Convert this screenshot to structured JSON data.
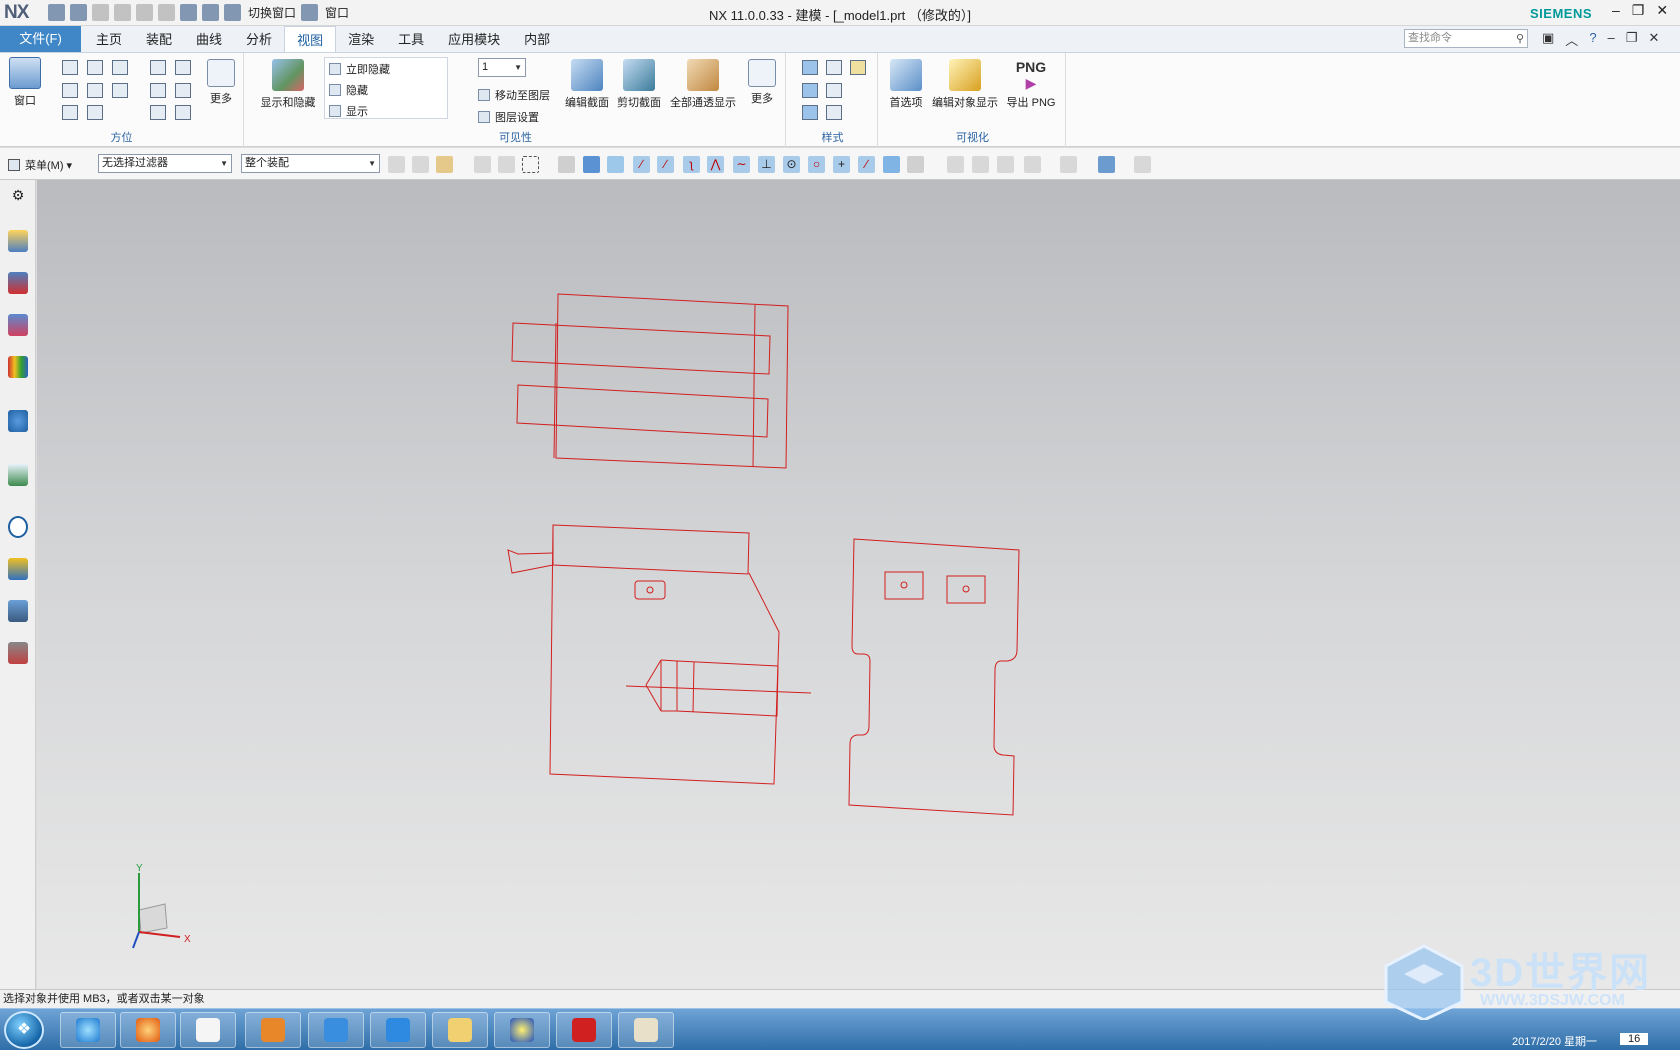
{
  "app": {
    "logo": "NX",
    "title": "NX 11.0.0.33 - 建模 - [_model1.prt （修改的）]",
    "brand": "SIEMENS",
    "switch_window": "切换窗口",
    "window": "窗口"
  },
  "menu": {
    "file": "文件(F)",
    "tabs": [
      "主页",
      "装配",
      "曲线",
      "分析",
      "视图",
      "渲染",
      "工具",
      "应用模块",
      "内部"
    ],
    "search_placeholder": "查找命令"
  },
  "ribbon": {
    "orient": {
      "window_label": "窗口",
      "more": "更多",
      "group": "方位"
    },
    "visibility": {
      "show_hide": "显示和隐藏",
      "immediate_hide": "立即隐藏",
      "hide": "隐藏",
      "show": "显示",
      "layer_value": "1",
      "move_to_layer": "移动至图层",
      "layer_settings": "图层设置",
      "edit_section": "编辑截面",
      "clip_section": "剪切截面",
      "all_through": "全部通透显示",
      "more": "更多",
      "group": "可见性"
    },
    "style": {
      "group": "样式"
    },
    "visual": {
      "preferences": "首选项",
      "edit_display": "编辑对象显示",
      "png_icon": "PNG",
      "export_png": "导出 PNG",
      "group": "可视化"
    }
  },
  "toolbar": {
    "menu": "菜单(M)",
    "filter": "无选择过滤器",
    "scope": "整个装配"
  },
  "status": "选择对象并使用 MB3，或者双击某一对象",
  "axis": {
    "x": "X",
    "y": "Y"
  },
  "tray": {
    "date": "2017/2/20 星期一",
    "time": "16"
  },
  "watermark": {
    "title": "3D世界网",
    "url": "WWW.3DSJW.COM"
  },
  "colors": {
    "accent": "#3f87c6",
    "wire": "#d21f1f",
    "siemens": "#009999"
  }
}
